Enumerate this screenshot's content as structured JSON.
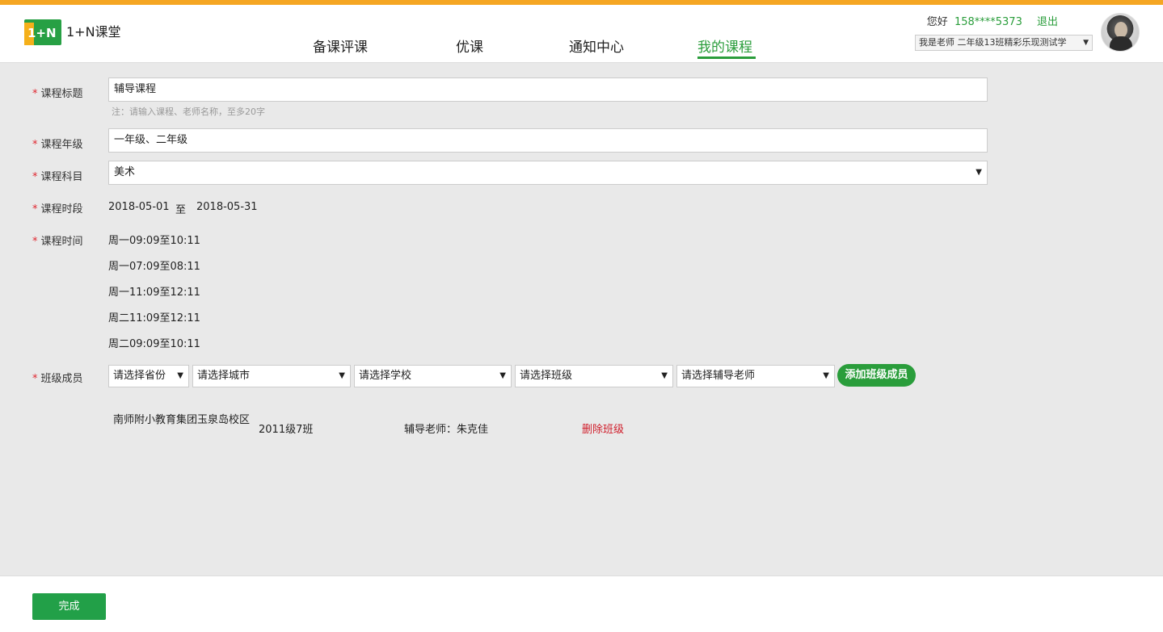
{
  "app": {
    "logo_mark": "1+N",
    "logo_text": "1+N课堂"
  },
  "nav": {
    "items": [
      {
        "label": "备课评课",
        "active": false
      },
      {
        "label": "优课",
        "active": false
      },
      {
        "label": "通知中心",
        "active": false
      },
      {
        "label": "我的课程",
        "active": true
      }
    ]
  },
  "user": {
    "greeting": "您好",
    "phone": "158****5373",
    "logout": "退出",
    "role_selected": "我是老师 二年级13班精彩乐现测试学"
  },
  "form": {
    "title": {
      "label": "课程标题",
      "value": "辅导课程",
      "note": "注：请输入课程、老师名称，至多20字"
    },
    "grade": {
      "label": "课程年级",
      "value": "一年级、二年级"
    },
    "subject": {
      "label": "课程科目",
      "value": "美术"
    },
    "period": {
      "label": "课程时段",
      "start": "2018-05-01",
      "sep": "至",
      "end": "2018-05-31"
    },
    "times": {
      "label": "课程时间",
      "items": [
        "周一09:09至10:11",
        "周一07:09至08:11",
        "周一11:09至12:11",
        "周二11:09至12:11",
        "周二09:09至10:11"
      ]
    },
    "members": {
      "label": "班级成员",
      "province_placeholder": "请选择省份",
      "city_placeholder": "请选择城市",
      "school_placeholder": "请选择学校",
      "class_placeholder": "请选择班级",
      "tutor_placeholder": "请选择辅导老师",
      "add_button": "添加班级成员",
      "rows": [
        {
          "school": "南师附小教育集团玉泉岛校区",
          "class": "2011级7班",
          "tutor": "辅导老师：朱克佳",
          "delete": "删除班级"
        }
      ]
    },
    "required_mark": "*"
  },
  "footer": {
    "done_button": "完成"
  },
  "colors": {
    "accent_green": "#2a9d3b",
    "top_bar_orange": "#f5a623",
    "required_red": "#e0262f",
    "delete_red": "#d01f2c"
  }
}
